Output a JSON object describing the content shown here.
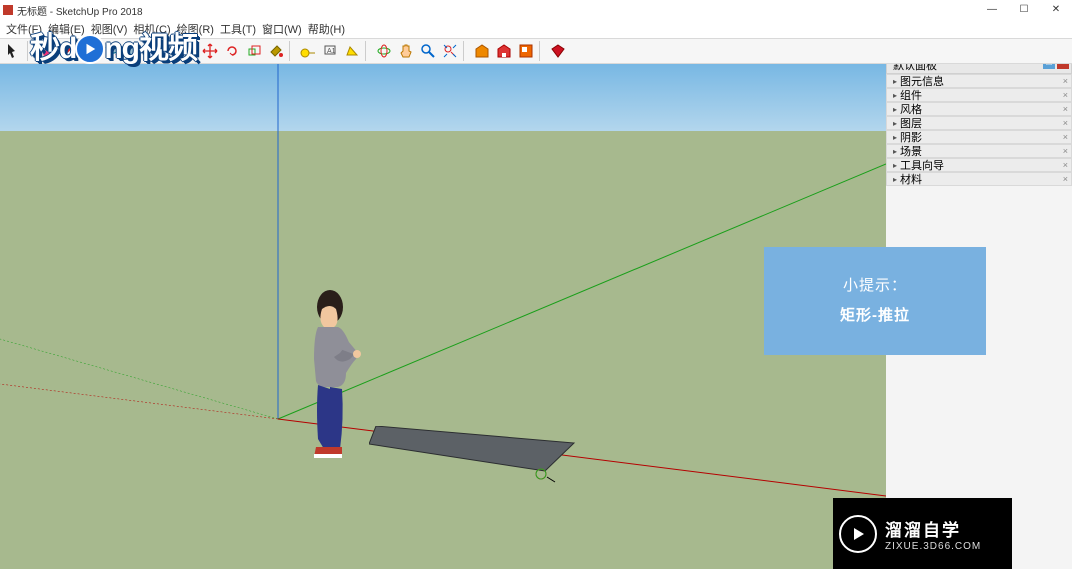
{
  "window": {
    "title": "无标题 - SketchUp Pro 2018"
  },
  "menus": [
    {
      "l": "文件(F)"
    },
    {
      "l": "编辑(E)"
    },
    {
      "l": "视图(V)"
    },
    {
      "l": "相机(C)"
    },
    {
      "l": "绘图(R)"
    },
    {
      "l": "工具(T)"
    },
    {
      "l": "窗口(W)"
    },
    {
      "l": "帮助(H)"
    }
  ],
  "toolbar_icons": [
    "select-arrow",
    "eraser",
    "line",
    "arc",
    "rectangle",
    "circle",
    "polygon",
    "push-pull",
    "offset",
    "move",
    "rotate",
    "scale",
    "paint",
    "tape",
    "text",
    "protractor",
    "orbit",
    "pan",
    "zoom",
    "zoom-extents",
    "section",
    "new",
    "outliner",
    "fog",
    "plugin"
  ],
  "tray": {
    "title": "默认面板",
    "panels": [
      {
        "l": "图元信息"
      },
      {
        "l": "组件"
      },
      {
        "l": "风格"
      },
      {
        "l": "图层"
      },
      {
        "l": "阴影"
      },
      {
        "l": "场景"
      },
      {
        "l": "工具向导"
      },
      {
        "l": "材料"
      }
    ]
  },
  "tip": {
    "head": "小提示：",
    "body": "矩形-推拉"
  },
  "overlay_watermark": {
    "a": "秒d",
    "b": "ng视频"
  },
  "footer_watermark": {
    "cn": "溜溜自学",
    "en": "ZIXUE.3D66.COM"
  }
}
